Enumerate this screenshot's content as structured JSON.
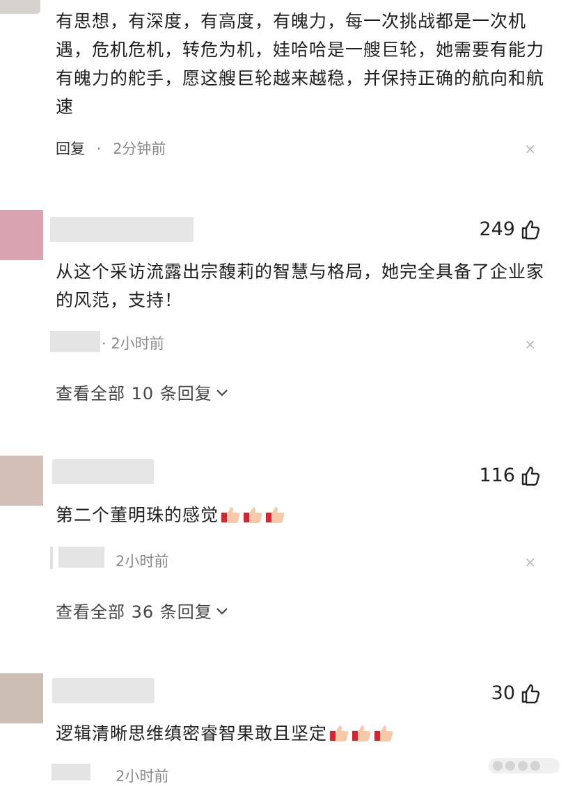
{
  "comments": [
    {
      "text": "有思想，有深度，有高度，有魄力，每一次挑战都是一次机遇，危机危机，转危为机，娃哈哈是一艘巨轮，她需要有能力有魄力的舵手，愿这艘巨轮越来越稳，并保持正确的航向和航速",
      "reply_label": "回复",
      "separator": "·",
      "time": "2分钟前",
      "close": "×"
    },
    {
      "likes": "249",
      "text": "从这个采访流露出宗馥莉的智慧与格局，她完全具备了企业家的风范，支持！",
      "separator": "·",
      "time": "2小时前",
      "close": "×",
      "view_all": "查看全部 10 条回复",
      "avatar_color": "#d9a3b2"
    },
    {
      "likes": "116",
      "text": "第二个董明珠的感觉",
      "time": "2小时前",
      "close": "×",
      "view_all": "查看全部 36 条回复",
      "avatar_color": "#d4bfb6"
    },
    {
      "likes": "30",
      "text": "逻辑清晰思维缜密睿智果敢且坚定",
      "time": "2小时前",
      "avatar_color": "#cdbeb3"
    }
  ]
}
